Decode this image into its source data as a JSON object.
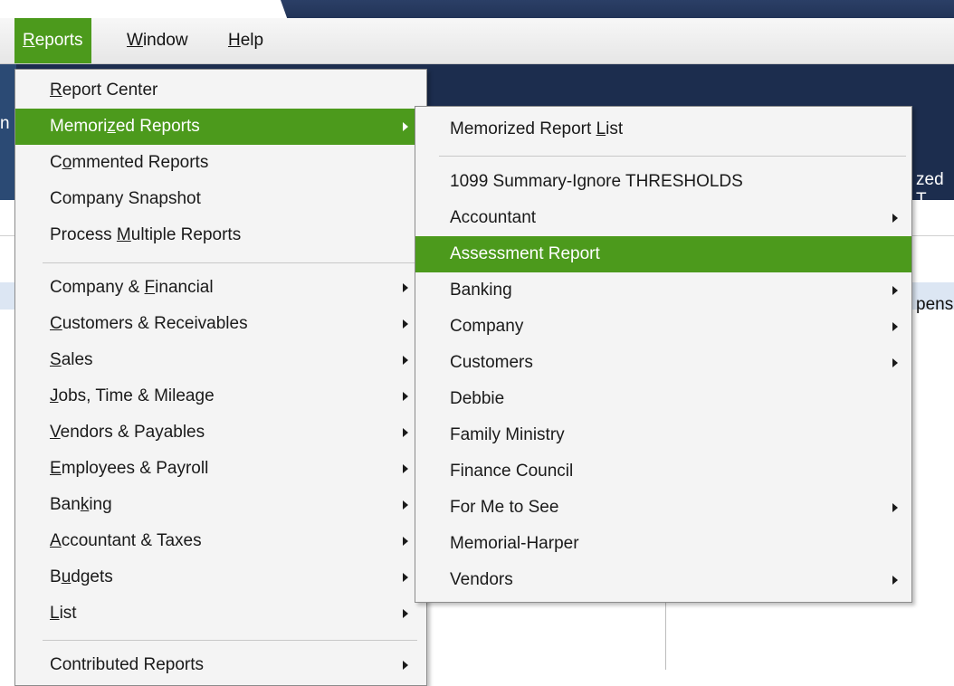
{
  "menubar": {
    "items": [
      {
        "pre": "",
        "mn": "R",
        "post": "eports"
      },
      {
        "pre": "",
        "mn": "W",
        "post": "indow"
      },
      {
        "pre": "",
        "mn": "H",
        "post": "elp"
      }
    ]
  },
  "background": {
    "peek_right_1": "zed T",
    "peek_right_2": "pens",
    "peek_left": "n"
  },
  "reports_menu": {
    "items": [
      {
        "pre": "",
        "mn": "R",
        "post": "eport Center",
        "submenu": false
      },
      {
        "pre": "Memori",
        "mn": "z",
        "post": "ed Reports",
        "submenu": true,
        "highlight": true
      },
      {
        "pre": "C",
        "mn": "o",
        "post": "mmented Reports",
        "submenu": false
      },
      {
        "pre": "Company Snapshot",
        "mn": "",
        "post": "",
        "submenu": false
      },
      {
        "pre": "Process ",
        "mn": "M",
        "post": "ultiple Reports",
        "submenu": false
      },
      {
        "pre": "Company & ",
        "mn": "F",
        "post": "inancial",
        "submenu": true
      },
      {
        "pre": "",
        "mn": "C",
        "post": "ustomers & Receivables",
        "submenu": true
      },
      {
        "pre": "",
        "mn": "S",
        "post": "ales",
        "submenu": true
      },
      {
        "pre": "",
        "mn": "J",
        "post": "obs, Time & Mileage",
        "submenu": true
      },
      {
        "pre": "",
        "mn": "V",
        "post": "endors & Payables",
        "submenu": true
      },
      {
        "pre": "",
        "mn": "E",
        "post": "mployees & Payroll",
        "submenu": true
      },
      {
        "pre": "Ban",
        "mn": "k",
        "post": "ing",
        "submenu": true
      },
      {
        "pre": "",
        "mn": "A",
        "post": "ccountant & Taxes",
        "submenu": true
      },
      {
        "pre": "B",
        "mn": "u",
        "post": "dgets",
        "submenu": true
      },
      {
        "pre": "",
        "mn": "L",
        "post": "ist",
        "submenu": true
      },
      {
        "pre": "Contributed Reports",
        "mn": "",
        "post": "",
        "submenu": true
      }
    ]
  },
  "memorized_menu": {
    "items": [
      {
        "pre": "Memorized Report ",
        "mn": "L",
        "post": "ist",
        "submenu": false
      },
      {
        "pre": "1099 Summary-Ignore THRESHOLDS",
        "mn": "",
        "post": "",
        "submenu": false
      },
      {
        "pre": "Accountant",
        "mn": "",
        "post": "",
        "submenu": true
      },
      {
        "pre": "Assessment Report",
        "mn": "",
        "post": "",
        "submenu": false,
        "highlight": true
      },
      {
        "pre": "Banking",
        "mn": "",
        "post": "",
        "submenu": true
      },
      {
        "pre": "Company",
        "mn": "",
        "post": "",
        "submenu": true
      },
      {
        "pre": "Customers",
        "mn": "",
        "post": "",
        "submenu": true
      },
      {
        "pre": "Debbie",
        "mn": "",
        "post": "",
        "submenu": false
      },
      {
        "pre": "Family Ministry",
        "mn": "",
        "post": "",
        "submenu": false
      },
      {
        "pre": "Finance Council",
        "mn": "",
        "post": "",
        "submenu": false
      },
      {
        "pre": "For Me to See",
        "mn": "",
        "post": "",
        "submenu": true
      },
      {
        "pre": "Memorial-Harper",
        "mn": "",
        "post": "",
        "submenu": false
      },
      {
        "pre": "Vendors",
        "mn": "",
        "post": "",
        "submenu": true
      }
    ]
  },
  "colors": {
    "highlight": "#4c9a1c",
    "navy": "#1c2d4e",
    "menu_bg": "#f4f4f4"
  }
}
